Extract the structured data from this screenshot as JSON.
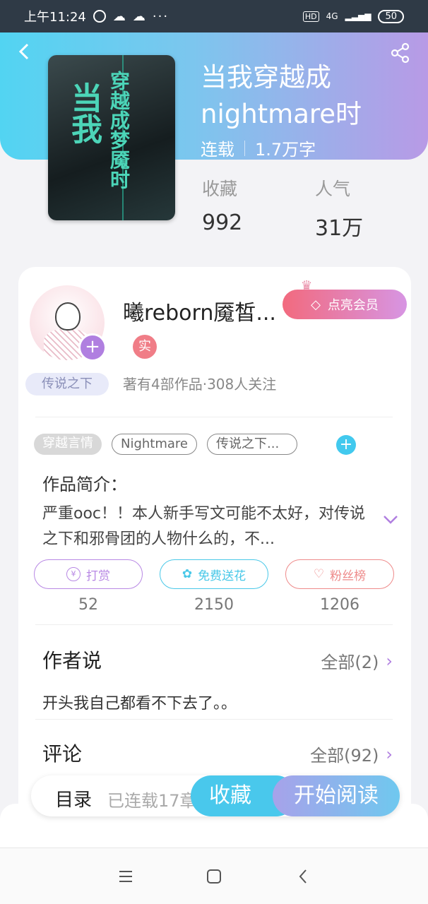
{
  "status_bar": {
    "time": "上午11:24",
    "network": "4G",
    "hd": "HD",
    "battery": "50"
  },
  "book": {
    "title": "当我穿越成nightmare时",
    "status": "连载",
    "word_count": "1.7万字",
    "cover_title_1": "当我",
    "cover_title_2": "穿越成梦魇时",
    "stats": {
      "fav_label": "收藏",
      "fav_value": "992",
      "pop_label": "人气",
      "pop_value": "31万"
    }
  },
  "author": {
    "name": "曦reborn魇皙...",
    "badge": "实",
    "tag": "传说之下",
    "stats": "著有4部作品·308人关注",
    "vip_label": "点亮会员"
  },
  "tags": [
    "穿越言情",
    "Nightmare",
    "传说之下..."
  ],
  "intro": {
    "heading": "作品简介：",
    "text": "严重ooc！！本人新手写文可能不太好，对传说之下和邪骨团的人物什么的，不..."
  },
  "actions": [
    {
      "label": "打赏",
      "count": "52"
    },
    {
      "label": "免费送花",
      "count": "2150"
    },
    {
      "label": "粉丝榜",
      "count": "1206"
    }
  ],
  "author_says": {
    "heading": "作者说",
    "all": "全部(2)",
    "text": "开头我自己都看不下去了。。"
  },
  "comments": {
    "heading": "评论",
    "all": "全部(92)"
  },
  "bottom": {
    "toc": "目录",
    "serial": "已连载17章",
    "fav": "收藏",
    "read": "开始阅读"
  }
}
